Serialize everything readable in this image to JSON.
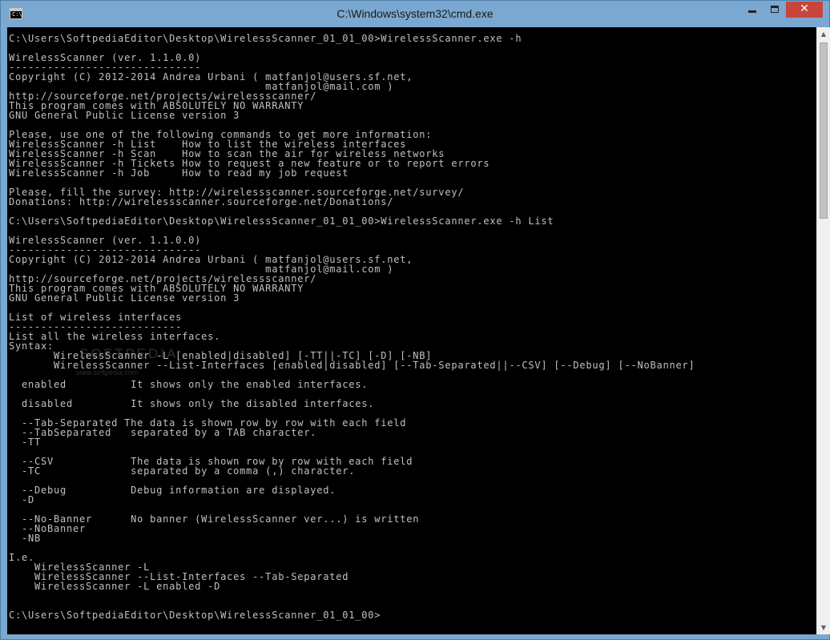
{
  "window": {
    "title": "C:\\Windows\\system32\\cmd.exe",
    "icon": "console-app-icon",
    "icon_text": "C:\\",
    "controls": {
      "minimize": "minimize-icon",
      "maximize": "maximize-icon",
      "close": "close-icon",
      "close_glyph": "✕",
      "close_color": "#c7463b"
    }
  },
  "console": {
    "background": "#000000",
    "foreground": "#c0c0c0",
    "lines": [
      "C:\\Users\\SoftpediaEditor\\Desktop\\WirelessScanner_01_01_00>WirelessScanner.exe -h",
      "",
      "WirelessScanner (ver. 1.1.0.0)",
      "------------------------------",
      "Copyright (C) 2012-2014 Andrea Urbani ( matfanjol@users.sf.net,",
      "                                        matfanjol@mail.com )",
      "http://sourceforge.net/projects/wirelessscanner/",
      "This program comes with ABSOLUTELY NO WARRANTY",
      "GNU General Public License version 3",
      "",
      "Please, use one of the following commands to get more information:",
      "WirelessScanner -h List    How to list the wireless interfaces",
      "WirelessScanner -h Scan    How to scan the air for wireless networks",
      "WirelessScanner -h Tickets How to request a new feature or to report errors",
      "WirelessScanner -h Job     How to read my job request",
      "",
      "Please, fill the survey: http://wirelessscanner.sourceforge.net/survey/",
      "Donations: http://wirelessscanner.sourceforge.net/Donations/",
      "",
      "C:\\Users\\SoftpediaEditor\\Desktop\\WirelessScanner_01_01_00>WirelessScanner.exe -h List",
      "",
      "WirelessScanner (ver. 1.1.0.0)",
      "------------------------------",
      "Copyright (C) 2012-2014 Andrea Urbani ( matfanjol@users.sf.net,",
      "                                        matfanjol@mail.com )",
      "http://sourceforge.net/projects/wirelessscanner/",
      "This program comes with ABSOLUTELY NO WARRANTY",
      "GNU General Public License version 3",
      "",
      "List of wireless interfaces",
      "---------------------------",
      "List all the wireless interfaces.",
      "Syntax:",
      "       WirelessScanner -L [enabled|disabled] [-TT||-TC] [-D] [-NB]",
      "       WirelessScanner --List-Interfaces [enabled|disabled] [--Tab-Separated||--CSV] [--Debug] [--NoBanner]",
      "",
      "  enabled          It shows only the enabled interfaces.",
      "",
      "  disabled         It shows only the disabled interfaces.",
      "",
      "  --Tab-Separated The data is shown row by row with each field",
      "  --TabSeparated   separated by a TAB character.",
      "  -TT",
      "",
      "  --CSV            The data is shown row by row with each field",
      "  -TC              separated by a comma (,) character.",
      "",
      "  --Debug          Debug information are displayed.",
      "  -D",
      "",
      "  --No-Banner      No banner (WirelessScanner ver...) is written",
      "  --NoBanner",
      "  -NB",
      "",
      "I.e.",
      "    WirelessScanner -L",
      "    WirelessScanner --List-Interfaces --Tab-Separated",
      "    WirelessScanner -L enabled -D",
      "",
      "",
      "C:\\Users\\SoftpediaEditor\\Desktop\\WirelessScanner_01_01_00>"
    ]
  },
  "watermark": {
    "text": "SOFTPEDIA",
    "subtext": "www.softpedia.com"
  },
  "scrollbar": {
    "up_icon": "scroll-up-arrow-icon",
    "down_icon": "scroll-down-arrow-icon",
    "up_glyph": "▲",
    "down_glyph": "▼"
  }
}
